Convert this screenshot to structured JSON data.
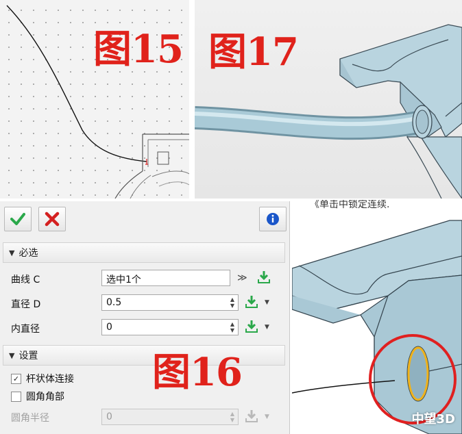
{
  "figures": {
    "fig15": "图15",
    "fig17": "图17",
    "fig16": "图16"
  },
  "caption_partial": "《单击中锁定连续.",
  "watermark": "中望3D",
  "dialog": {
    "ok_icon": "check-icon",
    "cancel_icon": "x-icon",
    "info_icon": "info-icon",
    "required_section": {
      "title": "必选",
      "arrow": "▼"
    },
    "curve": {
      "label": "曲线 C",
      "value": "选中1个"
    },
    "diameter": {
      "label": "直径 D",
      "value": "0.5"
    },
    "inner_diameter": {
      "label": "内直径",
      "value": "0"
    },
    "settings_section": {
      "title": "设置",
      "arrow": "▼"
    },
    "rod_connect": {
      "label": "杆状体连接",
      "checked": true,
      "mark": "✓"
    },
    "fillet_corner": {
      "label": "圆角角部",
      "checked": false
    },
    "fillet_radius": {
      "label": "圆角半径",
      "value": "0",
      "disabled": true
    }
  },
  "colors": {
    "accent_green": "#2aa84a",
    "cancel_red": "#d42020",
    "info_blue": "#1a56c9",
    "figure_label_red": "#e0221b",
    "model_blue": "#b8d4df",
    "highlight_circle": "#e02020",
    "hole_outline": "#f0b21a"
  }
}
